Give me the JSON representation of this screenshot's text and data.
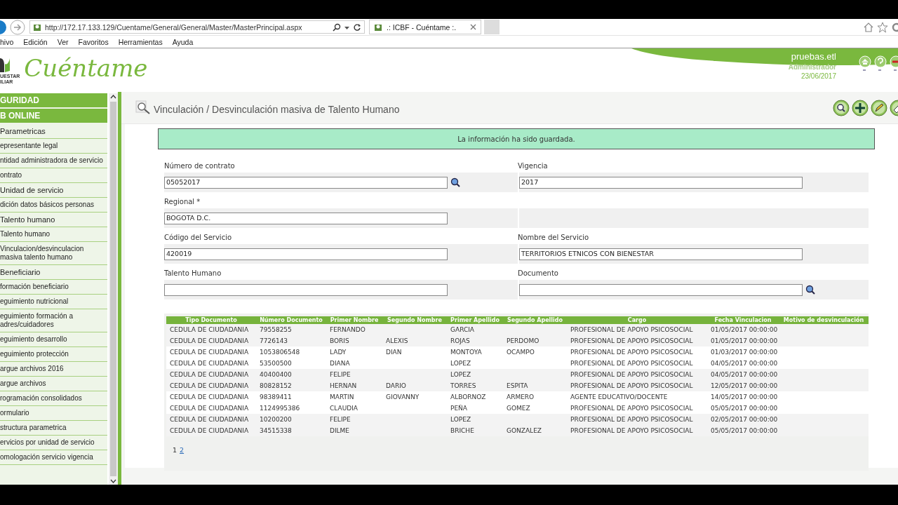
{
  "browser": {
    "url": "http://172.17.133.129/Cuentame/General/General/Master/MasterPrincipal.aspx",
    "tab_title": ".: ICBF - Cuéntame :.",
    "menu": [
      "hivo",
      "Edición",
      "Ver",
      "Favoritos",
      "Herramientas",
      "Ayuda"
    ]
  },
  "header": {
    "logo_caption": [
      "UESTAR",
      "ILIAR"
    ],
    "logo_text": "Cuéntame",
    "user": {
      "name": "pruebas.etl",
      "role": "Administrador",
      "date": "23/06/2017"
    }
  },
  "sidebar": {
    "items": [
      {
        "label": "GURIDAD",
        "kind": "section"
      },
      {
        "label": "B ONLINE",
        "kind": "section"
      },
      {
        "label": "Parametricas",
        "kind": "group"
      },
      {
        "label": "epresentante legal",
        "kind": "item"
      },
      {
        "label": "ntidad administradora de servicio",
        "kind": "item"
      },
      {
        "label": "ontrato",
        "kind": "item"
      },
      {
        "label": "Unidad de servicio",
        "kind": "group"
      },
      {
        "label": "dición datos básicos personas",
        "kind": "item"
      },
      {
        "label": "Talento humano",
        "kind": "group"
      },
      {
        "label": "Talento humano",
        "kind": "item"
      },
      {
        "label": "Vinculacion/desvinculacion masiva talento humano",
        "kind": "item"
      },
      {
        "label": "Beneficiario",
        "kind": "group"
      },
      {
        "label": "formación beneficiario",
        "kind": "item"
      },
      {
        "label": "eguimiento nutricional",
        "kind": "item"
      },
      {
        "label": "eguimiento formación a adres/cuidadores",
        "kind": "item"
      },
      {
        "label": "eguimiento desarrollo",
        "kind": "item"
      },
      {
        "label": "eguimiento protección",
        "kind": "item"
      },
      {
        "label": "argue archivos 2016",
        "kind": "item"
      },
      {
        "label": "argue archivos",
        "kind": "item"
      },
      {
        "label": "rogramación consolidados",
        "kind": "item"
      },
      {
        "label": "ormulario",
        "kind": "item"
      },
      {
        "label": "structura parametrica",
        "kind": "item"
      },
      {
        "label": "ervicios por unidad de servicio",
        "kind": "item"
      },
      {
        "label": "omologación servicio vigencia",
        "kind": "item"
      }
    ]
  },
  "page": {
    "title": "Vinculación / Desvinculación masiva de Talento Humano",
    "message": "La información ha sido guardada.",
    "form": [
      {
        "left": {
          "label": "Número de contrato",
          "value": "05052017",
          "lookup": true
        },
        "right": {
          "label": "Vigencia",
          "value": "2017",
          "lookup": false
        }
      },
      {
        "left": {
          "label": "Regional *",
          "value": "BOGOTA D.C.",
          "lookup": false
        }
      },
      {
        "left": {
          "label": "Código del Servicio",
          "value": "420019",
          "lookup": false
        },
        "right": {
          "label": "Nombre del Servicio",
          "value": "TERRITORIOS ETNICOS CON BIENESTAR",
          "lookup": false
        }
      },
      {
        "left": {
          "label": "Talento Humano",
          "lookup": false
        },
        "right": {
          "label": "Documento",
          "lookup": true
        }
      }
    ],
    "table": {
      "columns": [
        "Tipo Documento",
        "Número Documento",
        "Primer Nombre",
        "Segundo Nombre",
        "Primer Apellido",
        "Segundo Apellido",
        "Cargo",
        "Fecha Vinculacion",
        "Motivo de desvinculación"
      ],
      "rows": [
        [
          "CEDULA DE CIUDADANIA",
          "79558255",
          "FERNANDO",
          null,
          "GARCIA",
          null,
          "PROFESIONAL DE APOYO PSICOSOCIAL",
          "01/05/2017 00:00:00",
          null
        ],
        [
          "CEDULA DE CIUDADANIA",
          "7726143",
          "BORIS",
          "ALEXIS",
          "ROJAS",
          "PERDOMO",
          "PROFESIONAL DE APOYO PSICOSOCIAL",
          "01/05/2017 00:00:00",
          null
        ],
        [
          "CEDULA DE CIUDADANIA",
          "1053806548",
          "LADY",
          "DIAN",
          "MONTOYA",
          "OCAMPO",
          "PROFESIONAL DE APOYO PSICOSOCIAL",
          "01/03/2017 00:00:00",
          null
        ],
        [
          "CEDULA DE CIUDADANIA",
          "53500500",
          "DIANA",
          null,
          "LOPEZ",
          null,
          "PROFESIONAL DE APOYO PSICOSOCIAL",
          "04/05/2017 00:00:00",
          null
        ],
        [
          "CEDULA DE CIUDADANIA",
          "40400400",
          "FELIPE",
          null,
          "LOPEZ",
          null,
          "PROFESIONAL DE APOYO PSICOSOCIAL",
          "04/05/2017 00:00:00",
          null
        ],
        [
          "CEDULA DE CIUDADANIA",
          "80828152",
          "HERNAN",
          "DARIO",
          "TORRES",
          "ESPITA",
          "PROFESIONAL DE APOYO PSICOSOCIAL",
          "12/05/2017 00:00:00",
          null
        ],
        [
          "CEDULA DE CIUDADANIA",
          "98389411",
          "MARTIN",
          "GIOVANNY",
          "ALBORNOZ",
          "ARMERO",
          "AGENTE EDUCATIVO/DOCENTE",
          "14/05/2017 00:00:00",
          null
        ],
        [
          "CEDULA DE CIUDADANIA",
          "1124995386",
          "CLAUDIA",
          null,
          "PEÑA",
          "GOMEZ",
          "PROFESIONAL DE APOYO PSICOSOCIAL",
          "05/05/2017 00:00:00",
          null
        ],
        [
          "CEDULA DE CIUDADANIA",
          "10200200",
          "FELIPE",
          null,
          "LOPEZ",
          null,
          "PROFESIONAL DE APOYO PSICOSOCIAL",
          "02/05/2017 00:00:00",
          null
        ],
        [
          "CEDULA DE CIUDADANIA",
          "34515338",
          "DILME",
          null,
          "BRICHE",
          "GONZALEZ",
          "PROFESIONAL DE APOYO PSICOSOCIAL",
          "05/05/2017 00:00:00",
          null
        ]
      ]
    },
    "pager": [
      {
        "label": "1",
        "selected": true
      },
      {
        "label": "2",
        "selected": false
      }
    ]
  }
}
